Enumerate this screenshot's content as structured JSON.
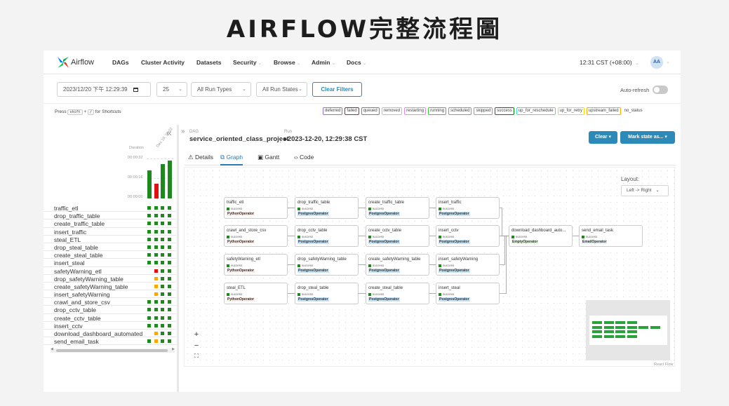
{
  "slide": {
    "title": "AIRFLOW完整流程圖"
  },
  "nav": {
    "brand": "Airflow",
    "items": [
      {
        "label": "DAGs",
        "dropdown": false
      },
      {
        "label": "Cluster Activity",
        "dropdown": false
      },
      {
        "label": "Datasets",
        "dropdown": false
      },
      {
        "label": "Security",
        "dropdown": true
      },
      {
        "label": "Browse",
        "dropdown": true
      },
      {
        "label": "Admin",
        "dropdown": true
      },
      {
        "label": "Docs",
        "dropdown": true
      }
    ],
    "time": "12:31 CST (+08:00)",
    "avatar": "AA"
  },
  "filters": {
    "datetime": "2023/12/20 下午 12:29:39",
    "count": "25",
    "run_types": "All Run Types",
    "run_states": "All Run States",
    "clear_filters": "Clear Filters",
    "auto_refresh": "Auto-refresh",
    "auto_refresh_on": false
  },
  "shortcuts": {
    "press": "Press",
    "key1": "shift",
    "plus": "+",
    "key2": "/",
    "text": "for Shortcuts"
  },
  "legend": [
    {
      "label": "deferred",
      "color": "#9370db"
    },
    {
      "label": "failed",
      "color": "#e01010"
    },
    {
      "label": "queued",
      "color": "#808080"
    },
    {
      "label": "removed",
      "color": "#c0c0c0"
    },
    {
      "label": "restarting",
      "color": "#ee82ee"
    },
    {
      "label": "running",
      "color": "#32cd32"
    },
    {
      "label": "scheduled",
      "color": "#8ea07a"
    },
    {
      "label": "skipped",
      "color": "#ff69b4"
    },
    {
      "label": "success",
      "color": "#008000"
    },
    {
      "label": "up_for_reschedule",
      "color": "#40e0d0"
    },
    {
      "label": "up_for_retry",
      "color": "#ffd700"
    },
    {
      "label": "upstream_failed",
      "color": "#ffa500"
    },
    {
      "label": "no_status",
      "color": ""
    }
  ],
  "grid": {
    "duration_label": "Duration",
    "durations": [
      "00:00:32",
      "00:00:16",
      "00:00:00"
    ],
    "date_header": "Dec 19, 10:02",
    "runs": [
      {
        "value": 23,
        "color": "#1e8a1e"
      },
      {
        "value": 12,
        "color": "#e01010"
      },
      {
        "value": 28,
        "color": "#1e8a1e"
      },
      {
        "value": 31,
        "color": "#1e8a1e"
      }
    ],
    "duration_max": 32
  },
  "tasks": [
    {
      "name": "traffic_etl",
      "states": [
        "success",
        "success",
        "success",
        "success"
      ]
    },
    {
      "name": "drop_traffic_table",
      "states": [
        "success",
        "success",
        "success",
        "success"
      ]
    },
    {
      "name": "create_traffic_table",
      "states": [
        "success",
        "success",
        "success",
        "success"
      ]
    },
    {
      "name": "insert_traffic",
      "states": [
        "success",
        "success",
        "success",
        "success"
      ]
    },
    {
      "name": "steal_ETL",
      "states": [
        "success",
        "success",
        "success",
        "success"
      ]
    },
    {
      "name": "drop_steal_table",
      "states": [
        "success",
        "success",
        "success",
        "success"
      ]
    },
    {
      "name": "create_steal_table",
      "states": [
        "success",
        "success",
        "success",
        "success"
      ]
    },
    {
      "name": "insert_steal",
      "states": [
        "success",
        "success",
        "success",
        "success"
      ]
    },
    {
      "name": "safetyWarning_etl",
      "states": [
        "",
        "failed",
        "success",
        "success"
      ]
    },
    {
      "name": "drop_safetyWarning_table",
      "states": [
        "",
        "upstream_failed",
        "success",
        "success"
      ]
    },
    {
      "name": "create_safetyWarning_table",
      "states": [
        "",
        "upstream_failed",
        "success",
        "success"
      ]
    },
    {
      "name": "insert_safetyWarning",
      "states": [
        "",
        "upstream_failed",
        "success",
        "success"
      ]
    },
    {
      "name": "crawl_and_store_csv",
      "states": [
        "success",
        "success",
        "success",
        "success"
      ]
    },
    {
      "name": "drop_cctv_table",
      "states": [
        "success",
        "success",
        "success",
        "success"
      ]
    },
    {
      "name": "create_cctv_table",
      "states": [
        "success",
        "success",
        "success",
        "success"
      ]
    },
    {
      "name": "insert_cctv",
      "states": [
        "success",
        "success",
        "success",
        "success"
      ]
    },
    {
      "name": "download_dashboard_automated",
      "states": [
        "",
        "upstream_failed",
        "success",
        "success"
      ]
    },
    {
      "name": "send_email_task",
      "states": [
        "success",
        "upstream_failed",
        "success",
        "success"
      ]
    }
  ],
  "state_colors": {
    "success": "#1e8a1e",
    "failed": "#e01010",
    "upstream_failed": "#ffa500"
  },
  "breadcrumb": {
    "dag_label": "DAG",
    "dag_value": "service_oriented_class_project",
    "run_label": "Run",
    "run_value": "2023-12-20, 12:29:38 CST"
  },
  "actions": {
    "clear": "Clear",
    "mark_state": "Mark state as..."
  },
  "tabs": [
    {
      "label": "Details",
      "icon": "alert-triangle-icon",
      "active": false
    },
    {
      "label": "Graph",
      "icon": "graph-icon",
      "active": true
    },
    {
      "label": "Gantt",
      "icon": "gantt-icon",
      "active": false
    },
    {
      "label": "Code",
      "icon": "code-icon",
      "active": false
    }
  ],
  "graph": {
    "layout_label": "Layout:",
    "layout_value": "Left -> Right",
    "zoom_in": "+",
    "zoom_out": "−",
    "fit": "⛶",
    "attribution": "React Flow",
    "nodes": [
      {
        "id": "traffic_etl",
        "title": "traffic_etl",
        "status": "success",
        "operator": "PythonOperator",
        "col": 0,
        "row": 0
      },
      {
        "id": "drop_traffic_table",
        "title": "drop_traffic_table",
        "status": "success",
        "operator": "PostgresOperator",
        "col": 1,
        "row": 0
      },
      {
        "id": "create_traffic_table",
        "title": "create_traffic_table",
        "status": "success",
        "operator": "PostgresOperator",
        "col": 2,
        "row": 0
      },
      {
        "id": "insert_traffic",
        "title": "insert_traffic",
        "status": "success",
        "operator": "PostgresOperator",
        "col": 3,
        "row": 0
      },
      {
        "id": "crawl_and_store_csv",
        "title": "crawl_and_store_csv",
        "status": "success",
        "operator": "PythonOperator",
        "col": 0,
        "row": 1
      },
      {
        "id": "drop_cctv_table",
        "title": "drop_cctv_table",
        "status": "success",
        "operator": "PostgresOperator",
        "col": 1,
        "row": 1
      },
      {
        "id": "create_cctv_table",
        "title": "create_cctv_table",
        "status": "success",
        "operator": "PostgresOperator",
        "col": 2,
        "row": 1
      },
      {
        "id": "insert_cctv",
        "title": "insert_cctv",
        "status": "success",
        "operator": "PostgresOperator",
        "col": 3,
        "row": 1
      },
      {
        "id": "safetyWarning_etl",
        "title": "safetyWarning_etl",
        "status": "success",
        "operator": "PythonOperator",
        "col": 0,
        "row": 2
      },
      {
        "id": "drop_safetyWarning_table",
        "title": "drop_safetyWarning_table",
        "status": "success",
        "operator": "PostgresOperator",
        "col": 1,
        "row": 2
      },
      {
        "id": "create_safetyWarning_table",
        "title": "create_safetyWarning_table",
        "status": "success",
        "operator": "PostgresOperator",
        "col": 2,
        "row": 2
      },
      {
        "id": "insert_safetyWarning",
        "title": "insert_safetyWarning",
        "status": "success",
        "operator": "PostgresOperator",
        "col": 3,
        "row": 2
      },
      {
        "id": "steal_ETL",
        "title": "steal_ETL",
        "status": "success",
        "operator": "PythonOperator",
        "col": 0,
        "row": 3
      },
      {
        "id": "drop_steal_table",
        "title": "drop_steal_table",
        "status": "success",
        "operator": "PostgresOperator",
        "col": 1,
        "row": 3
      },
      {
        "id": "create_steal_table",
        "title": "create_steal_table",
        "status": "success",
        "operator": "PostgresOperator",
        "col": 2,
        "row": 3
      },
      {
        "id": "insert_steal",
        "title": "insert_steal",
        "status": "success",
        "operator": "PostgresOperator",
        "col": 3,
        "row": 3
      },
      {
        "id": "download_dashboard_automated",
        "title": "download_dashboard_auto...",
        "status": "success",
        "operator": "EmptyOperator",
        "col": 4,
        "row": 1
      },
      {
        "id": "send_email_task",
        "title": "send_email_task",
        "status": "success",
        "operator": "EmailOperator",
        "col": 5,
        "row": 1
      }
    ],
    "operator_colors": {
      "PythonOperator": "#ffefeb",
      "PostgresOperator": "#c7e4f6",
      "EmptyOperator": "#e8f7e4",
      "EmailOperator": "#e6f1f2"
    }
  }
}
